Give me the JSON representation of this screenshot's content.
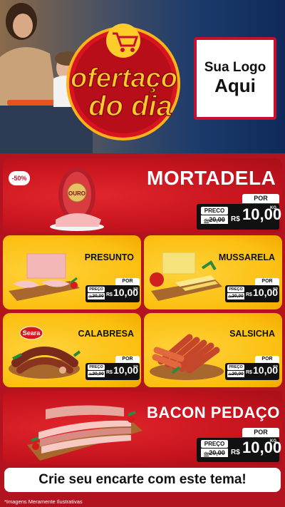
{
  "header": {
    "logo_text_line1": "ofertaço",
    "logo_text_line2": "do dia",
    "brand_box_line1": "Sua Logo",
    "brand_box_line2": "Aqui"
  },
  "featured": {
    "badge": "-50%",
    "name": "MORTADELA",
    "brand": "OURO",
    "price_label": "PRECO",
    "por_label": "POR",
    "de_label": "de",
    "old_price": "20,00",
    "currency": "R$",
    "price": "10,00",
    "unit": "KG"
  },
  "products": [
    {
      "name": "PRESUNTO",
      "por_label": "POR",
      "preco_label": "PREÇO",
      "de_label": "de",
      "old_price": "20,00",
      "currency": "R$",
      "price": "10,00",
      "unit": "KG"
    },
    {
      "name": "MUSSARELA",
      "por_label": "POR",
      "preco_label": "PREÇO",
      "de_label": "de",
      "old_price": "20,00",
      "currency": "R$",
      "price": "10,00",
      "unit": "KG"
    },
    {
      "name": "CALABRESA",
      "brand": "Seara",
      "por_label": "POR",
      "preco_label": "PREÇO",
      "de_label": "de",
      "old_price": "20,00",
      "currency": "R$",
      "price": "10,00",
      "unit": "KG"
    },
    {
      "name": "SALSICHA",
      "por_label": "POR",
      "preco_label": "PREÇO",
      "de_label": "de",
      "old_price": "20,00",
      "currency": "R$",
      "price": "10,00",
      "unit": "KG"
    }
  ],
  "bacon": {
    "name": "BACON PEDAÇO",
    "price_label": "PREÇO",
    "por_label": "POR",
    "de_label": "de",
    "old_price": "20,00",
    "currency": "R$",
    "price": "10,00",
    "unit": "KG"
  },
  "cta": "Crie seu encarte com este tema!",
  "disclaimer": "*Imagens Meramente Ilustrativas",
  "colors": {
    "red": "#c6141e",
    "yellow": "#fbbf10",
    "dark": "#111111"
  }
}
